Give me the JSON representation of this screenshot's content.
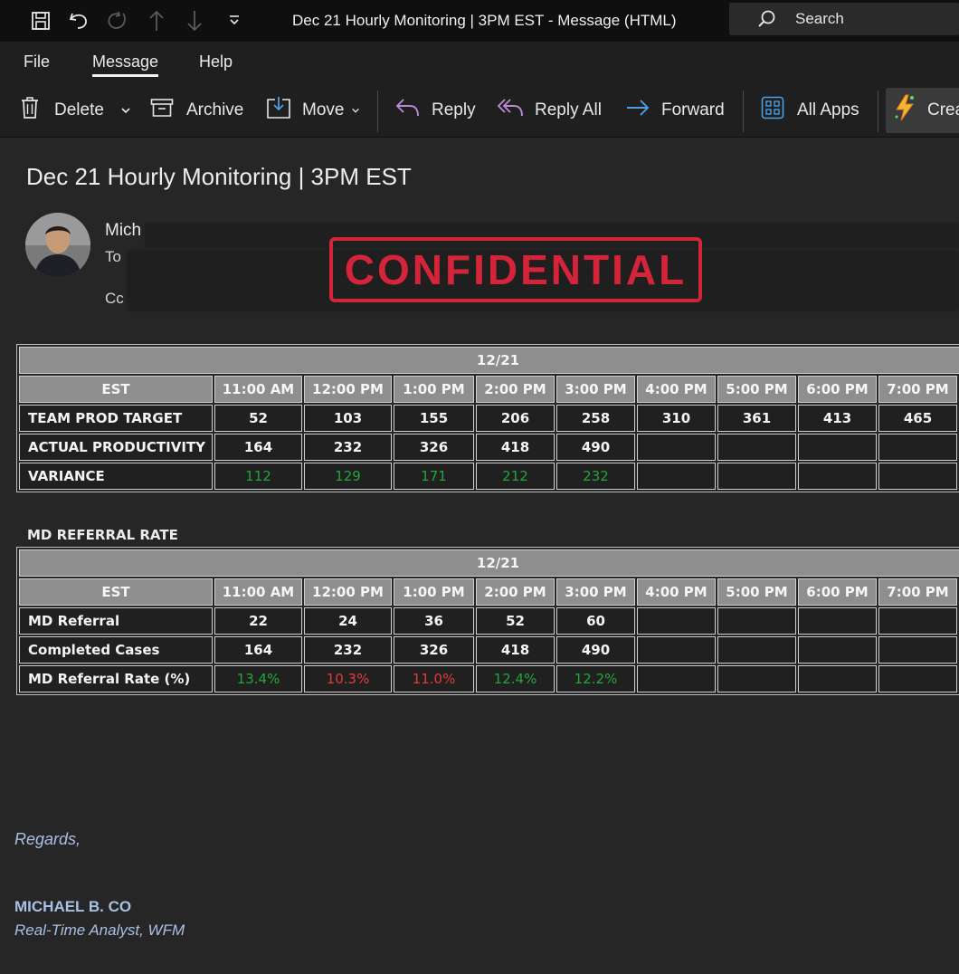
{
  "window": {
    "title": "Dec 21 Hourly Monitoring | 3PM EST  -  Message (HTML)",
    "search_label": "Search"
  },
  "menu": {
    "tabs": [
      "File",
      "Message",
      "Help"
    ],
    "active": "Message"
  },
  "toolbar": {
    "delete": "Delete",
    "archive": "Archive",
    "move": "Move",
    "reply": "Reply",
    "reply_all": "Reply All",
    "forward": "Forward",
    "all_apps": "All Apps",
    "create": "Crea"
  },
  "message": {
    "subject": "Dec 21 Hourly Monitoring | 3PM EST",
    "sender_visible": "Mich",
    "to_label": "To",
    "cc_label": "Cc",
    "stamp": "CONFIDENTIAL"
  },
  "productivity_table": {
    "date": "12/21",
    "est_label": "EST",
    "times": [
      "11:00 AM",
      "12:00 PM",
      "1:00 PM",
      "2:00 PM",
      "3:00 PM",
      "4:00 PM",
      "5:00 PM",
      "6:00 PM",
      "7:00 PM"
    ],
    "rows": [
      {
        "label": "TEAM PROD TARGET",
        "values": [
          "52",
          "103",
          "155",
          "206",
          "258",
          "310",
          "361",
          "413",
          "465"
        ],
        "style": "plain"
      },
      {
        "label": "ACTUAL PRODUCTIVITY",
        "values": [
          "164",
          "232",
          "326",
          "418",
          "490",
          "",
          "",
          "",
          ""
        ],
        "style": "plain"
      },
      {
        "label": "VARIANCE",
        "values": [
          "112",
          "129",
          "171",
          "212",
          "232",
          "",
          "",
          "",
          ""
        ],
        "style": "colored",
        "status": [
          "pos",
          "pos",
          "pos",
          "pos",
          "pos",
          "",
          "",
          "",
          ""
        ]
      }
    ]
  },
  "referral_section_label": "MD REFERRAL RATE",
  "referral_table": {
    "date": "12/21",
    "est_label": "EST",
    "times": [
      "11:00 AM",
      "12:00 PM",
      "1:00 PM",
      "2:00 PM",
      "3:00 PM",
      "4:00 PM",
      "5:00 PM",
      "6:00 PM",
      "7:00 PM"
    ],
    "rows": [
      {
        "label": "MD Referral",
        "values": [
          "22",
          "24",
          "36",
          "52",
          "60",
          "",
          "",
          "",
          ""
        ],
        "style": "plain"
      },
      {
        "label": "Completed Cases",
        "values": [
          "164",
          "232",
          "326",
          "418",
          "490",
          "",
          "",
          "",
          ""
        ],
        "style": "plain"
      },
      {
        "label": "MD Referral Rate (%)",
        "values": [
          "13.4%",
          "10.3%",
          "11.0%",
          "12.4%",
          "12.2%",
          "",
          "",
          "",
          ""
        ],
        "style": "colored",
        "status": [
          "pos",
          "neg",
          "neg",
          "pos",
          "pos",
          "",
          "",
          "",
          ""
        ]
      }
    ]
  },
  "signature": {
    "regards": "Regards,",
    "name": "MICHAEL B. CO",
    "role": "Real-Time Analyst, WFM"
  },
  "colors": {
    "positive": "#22a63a",
    "negative": "#e23a3a",
    "stamp": "#d4243a",
    "signature": "#a9c0e4"
  }
}
